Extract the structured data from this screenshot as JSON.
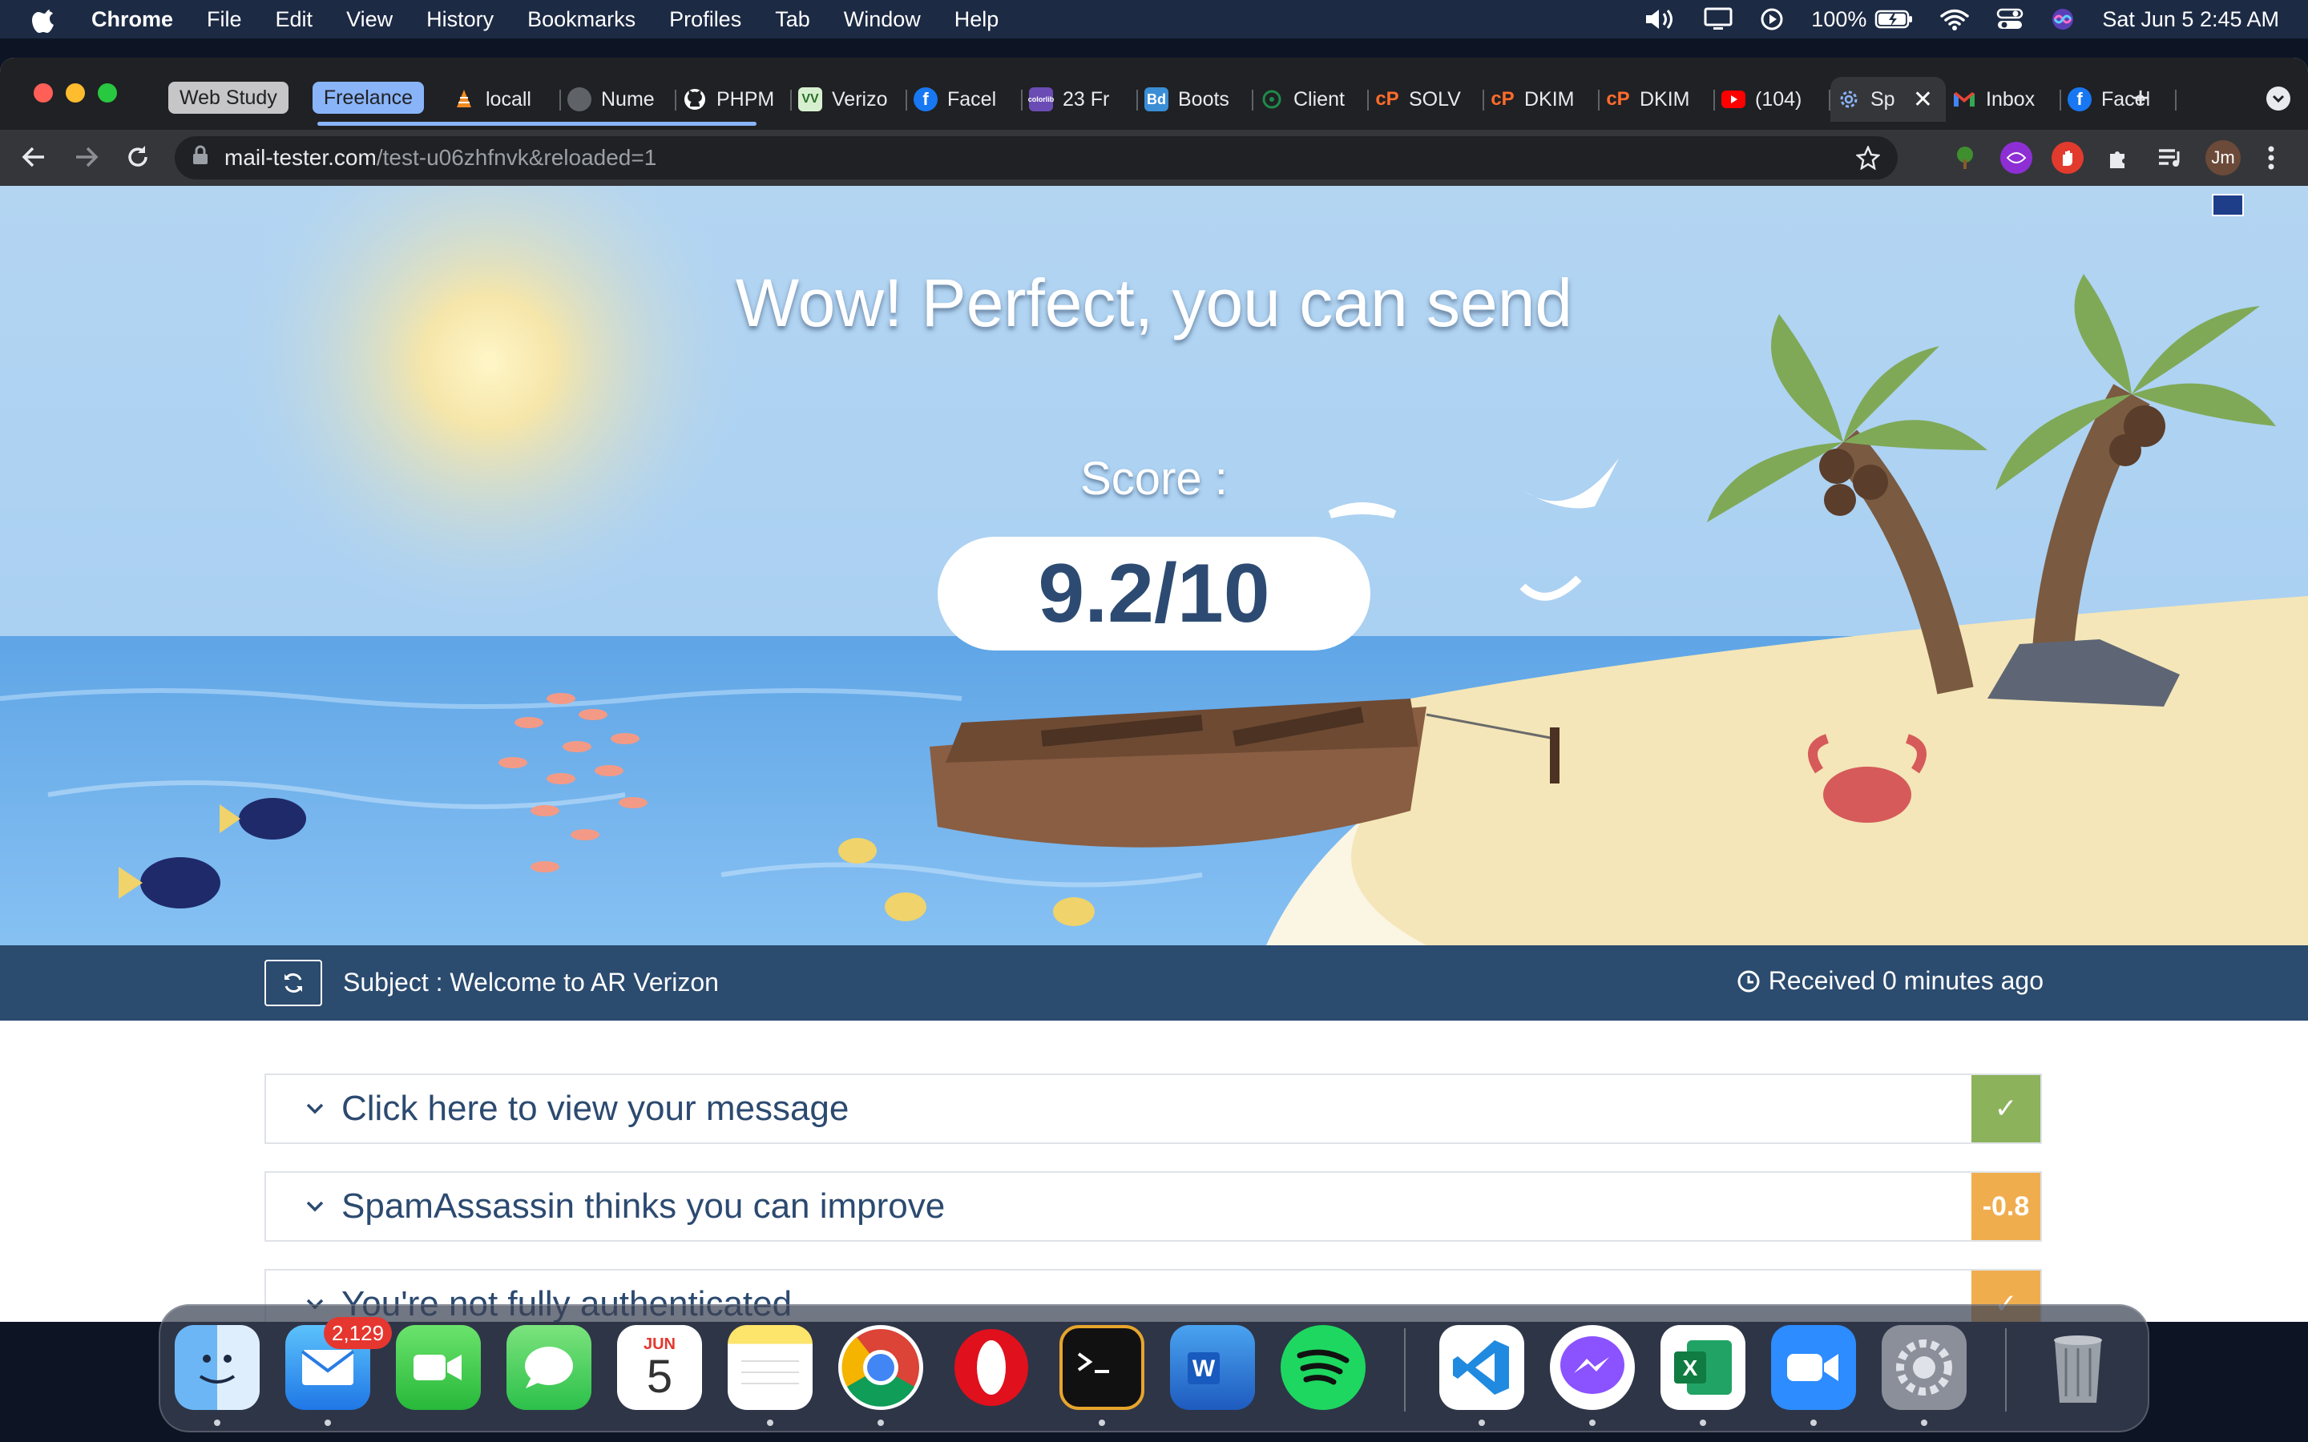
{
  "menubar": {
    "app_name": "Chrome",
    "menus": [
      "File",
      "Edit",
      "View",
      "History",
      "Bookmarks",
      "Profiles",
      "Tab",
      "Window",
      "Help"
    ],
    "battery": "100%",
    "datetime": "Sat Jun 5  2:45 AM"
  },
  "browser": {
    "tab_groups": [
      "Web Study",
      "Freelance"
    ],
    "tabs": [
      {
        "label": "locall",
        "icon": "vlc-cone-icon"
      },
      {
        "label": "Nume",
        "icon": "globe-icon"
      },
      {
        "label": "PHPM",
        "icon": "github-icon"
      },
      {
        "label": "Verizo",
        "icon": "verizon-icon"
      },
      {
        "label": "Facel",
        "icon": "facebook-icon"
      },
      {
        "label": "23 Fr",
        "icon": "colorlib-icon"
      },
      {
        "label": "Boots",
        "icon": "bootstrap-icon"
      },
      {
        "label": "Client",
        "icon": "client-icon"
      },
      {
        "label": "SOLV",
        "icon": "cpanel-icon"
      },
      {
        "label": "DKIM",
        "icon": "cpanel-icon"
      },
      {
        "label": "DKIM",
        "icon": "cpanel-icon"
      },
      {
        "label": "(104)",
        "icon": "youtube-icon"
      },
      {
        "label": "Sp",
        "icon": "settings-gear-icon",
        "active": true
      },
      {
        "label": "Inbox",
        "icon": "gmail-icon"
      },
      {
        "label": "Facel",
        "icon": "facebook-icon"
      }
    ],
    "url_host": "mail-tester.com",
    "url_path": "/test-u06zhfnvk&reloaded=1",
    "profile_initials": "Jm"
  },
  "page": {
    "headline": "Wow! Perfect, you can send",
    "score_label": "Score :",
    "score": "9.2/10",
    "subject": "Subject : Welcome to AR Verizon",
    "received": "Received 0 minutes ago",
    "results": [
      {
        "title": "Click here to view your message",
        "badge": "✓",
        "badge_color": "#8db25c"
      },
      {
        "title": "SpamAssassin thinks you can improve",
        "badge": "-0.8",
        "badge_color": "#f0ad4e"
      },
      {
        "title": "You're not fully authenticated",
        "badge": "✓",
        "badge_color": "#f0ad4e"
      }
    ]
  },
  "dock": {
    "apps": [
      "Finder",
      "Mail",
      "FaceTime",
      "Messages",
      "Calendar",
      "Notes",
      "Chrome",
      "Opera",
      "Terminal",
      "Word",
      "Spotify",
      "VS Code",
      "Messenger",
      "Excel",
      "Zoom",
      "System Preferences",
      "Trash"
    ],
    "mail_badge": "2,129",
    "calendar_month": "JUN",
    "calendar_day": "5"
  }
}
